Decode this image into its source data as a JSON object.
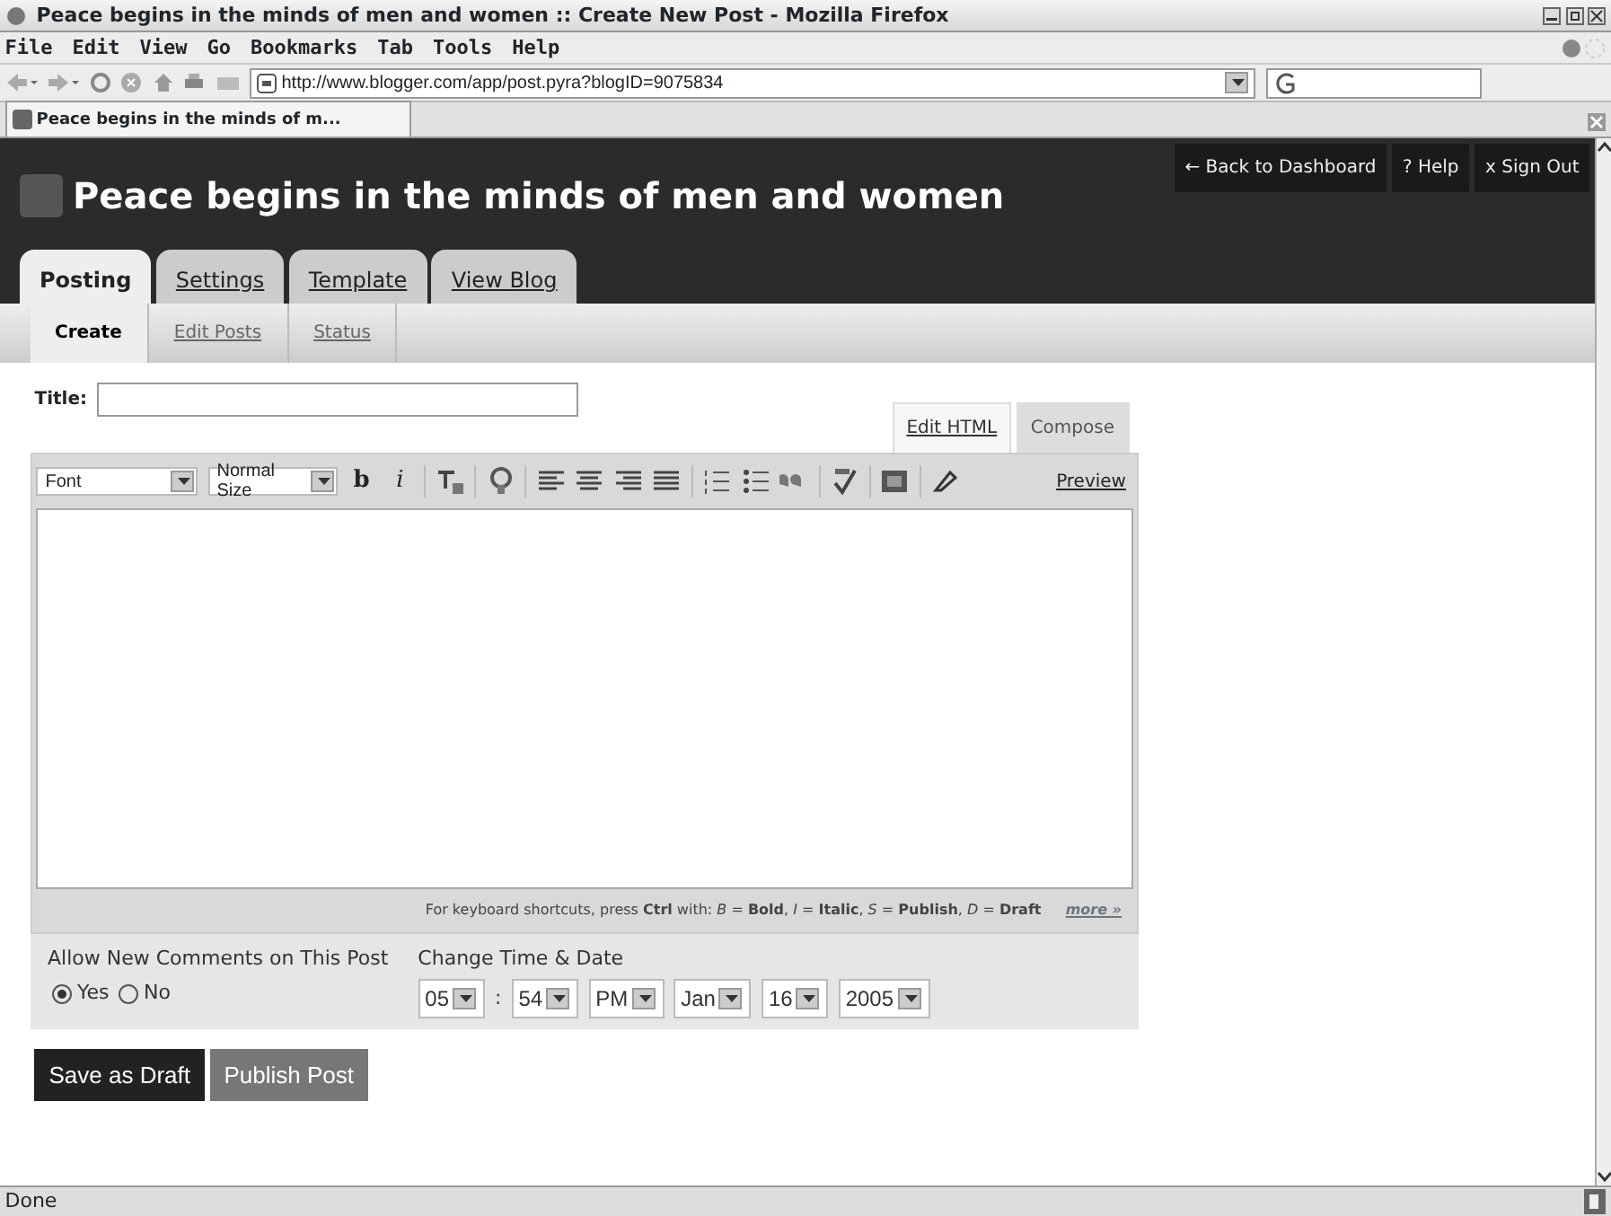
{
  "window": {
    "title": "Peace begins in the minds of men and women :: Create New Post - Mozilla Firefox"
  },
  "menu": [
    "File",
    "Edit",
    "View",
    "Go",
    "Bookmarks",
    "Tab",
    "Tools",
    "Help"
  ],
  "address_bar": {
    "value": "http://www.blogger.com/app/post.pyra?blogID=9075834"
  },
  "browser_tabs": [
    {
      "label": "Peace begins in the minds of m...",
      "selected": true
    }
  ],
  "blog": {
    "title": "Peace begins in the minds of men and women",
    "top_links": [
      "← Back to Dashboard",
      "? Help",
      "x Sign Out"
    ],
    "tabs": [
      {
        "label": "Posting",
        "selected": true
      },
      {
        "label": "Settings",
        "selected": false
      },
      {
        "label": "Template",
        "selected": false
      },
      {
        "label": "View Blog",
        "selected": false
      }
    ],
    "subtabs": [
      {
        "label": "Create",
        "selected": true
      },
      {
        "label": "Edit Posts",
        "selected": false
      },
      {
        "label": "Status",
        "selected": false
      }
    ]
  },
  "post": {
    "title_label": "Title:",
    "editor_modes": [
      {
        "label": "Edit HTML",
        "selected": false
      },
      {
        "label": "Compose",
        "selected": true
      }
    ],
    "font_select": "Font",
    "size_select": "Normal Size",
    "toolbar": [
      {
        "kind": "bold",
        "label": "b"
      },
      {
        "kind": "italic",
        "label": "i"
      }
    ],
    "preview": "Preview",
    "shortcuts": "For keyboard shortcuts, press **Ctrl** with: *B* = **Bold**, *I* = **Italic**, *S* = **Publish**, *D* = **Draft**",
    "more": "more »",
    "comments_label": "Allow New Comments on This Post",
    "comment_options": [
      {
        "label": "Yes",
        "selected": true
      },
      {
        "label": "No",
        "selected": false
      }
    ],
    "date_label": "Change Time & Date",
    "date_fields": [
      {
        "value": "05"
      },
      {
        "value": "54",
        "sep": ":"
      },
      {
        "value": "PM"
      },
      {
        "value": "Jan"
      },
      {
        "value": "16"
      },
      {
        "value": "2005"
      }
    ],
    "buttons": [
      {
        "label": "Save as Draft",
        "kind": "primary"
      },
      {
        "label": "Publish Post",
        "kind": "secondary"
      }
    ]
  },
  "status_bar": "Done"
}
